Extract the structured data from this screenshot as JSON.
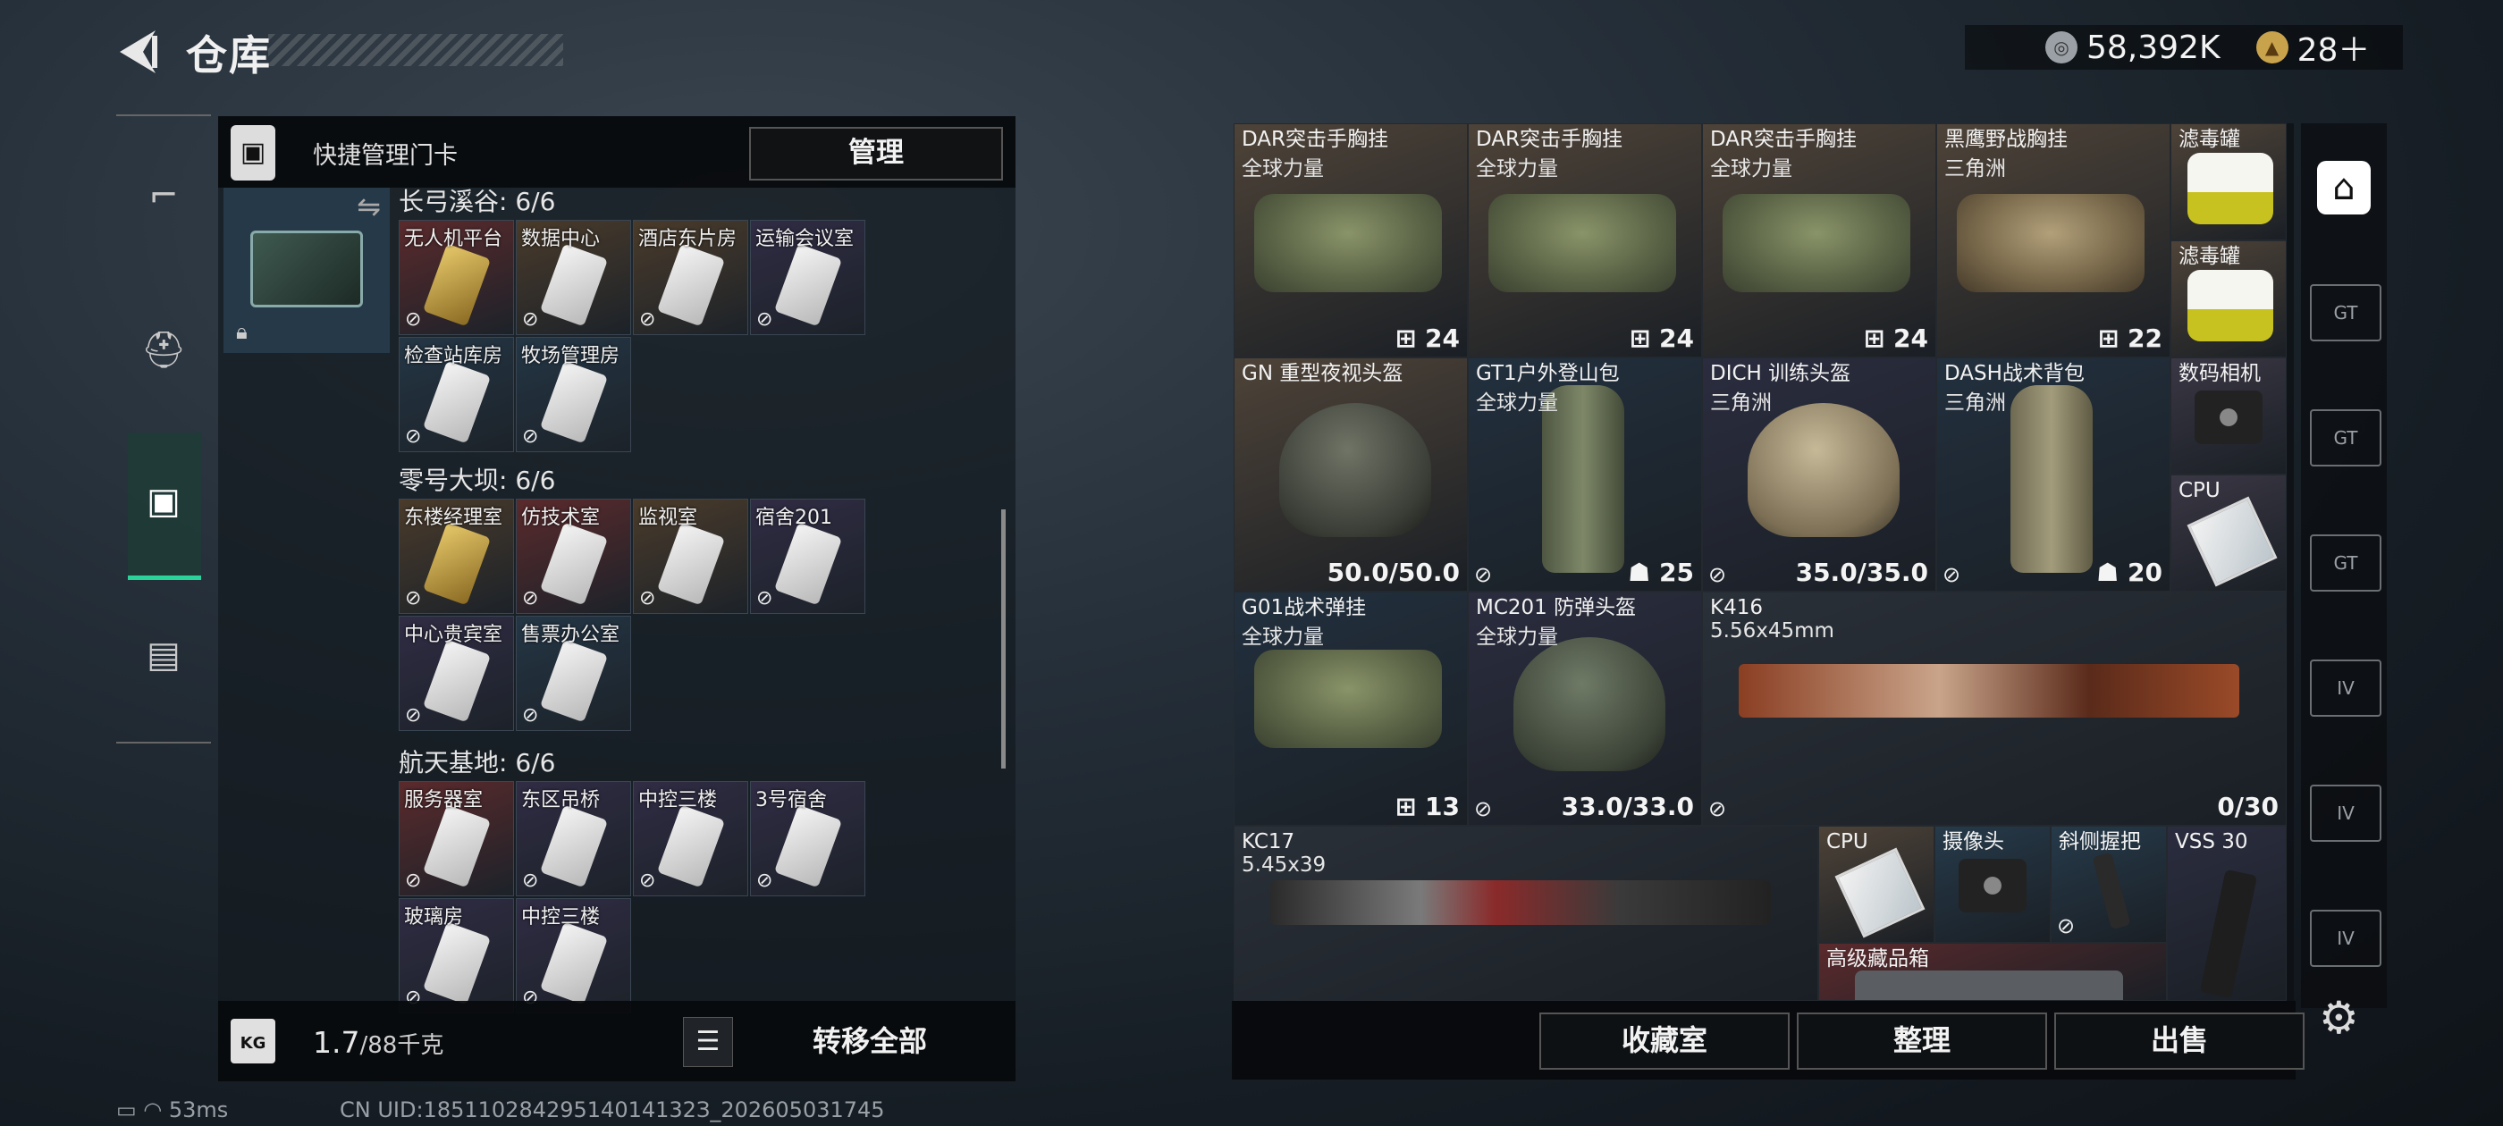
{
  "header": {
    "title": "仓库",
    "currency1": "58,392K",
    "currency2": "28＋"
  },
  "quick_card": {
    "label": "快捷管理门卡",
    "manage": "管理"
  },
  "maps": [
    {
      "title": "长弓溪谷: 6/6",
      "keys": [
        "无人机平台",
        "数据中心",
        "酒店东片房",
        "运输会议室",
        "检查站库房",
        "牧场管理房"
      ]
    },
    {
      "title": "零号大坝: 6/6",
      "keys": [
        "东楼经理室",
        "仿技术室",
        "监视室",
        "宿舍201",
        "中心贵宾室",
        "售票办公室"
      ]
    },
    {
      "title": "航天基地: 6/6",
      "keys": [
        "服务器室",
        "东区吊桥",
        "中控三楼",
        "3号宿舍",
        "玻璃房",
        "中控三楼"
      ]
    }
  ],
  "footer_left": {
    "weight": "1.7",
    "capacity": "/88千克",
    "transfer": "转移全部"
  },
  "items": [
    {
      "name": "DAR突击手胸挂",
      "sub": "全球力量",
      "count": "24"
    },
    {
      "name": "DAR突击手胸挂",
      "sub": "全球力量",
      "count": "24"
    },
    {
      "name": "DAR突击手胸挂",
      "sub": "全球力量",
      "count": "24"
    },
    {
      "name": "黑鹰野战胸挂",
      "sub": "三角洲",
      "count": "22"
    },
    {
      "name": "滤毒罐",
      "sub": "",
      "count": ""
    },
    {
      "name": "滤毒罐",
      "sub": "",
      "count": ""
    },
    {
      "name": "GN 重型夜视头盔",
      "sub": "",
      "count": "50.0/50.0"
    },
    {
      "name": "GT1户外登山包",
      "sub": "全球力量",
      "count": "25"
    },
    {
      "name": "DICH 训练头盔",
      "sub": "三角洲",
      "count": "35.0/35.0"
    },
    {
      "name": "DASH战术背包",
      "sub": "三角洲",
      "count": "20"
    },
    {
      "name": "数码相机",
      "sub": "",
      "count": ""
    },
    {
      "name": "CPU",
      "sub": "",
      "count": ""
    },
    {
      "name": "G01战术弹挂",
      "sub": "全球力量",
      "count": "13"
    },
    {
      "name": "MC201 防弹头盔",
      "sub": "全球力量",
      "count": "33.0/33.0"
    },
    {
      "name": "K416",
      "sub": "5.56x45mm",
      "count": "0/30"
    },
    {
      "name": "KC17",
      "sub": "5.45x39",
      "count": ""
    },
    {
      "name": "CPU",
      "sub": "",
      "count": ""
    },
    {
      "name": "摄像头",
      "sub": "",
      "count": ""
    },
    {
      "name": "斜侧握把",
      "sub": "",
      "count": ""
    },
    {
      "name": "VSS 30",
      "sub": "",
      "count": ""
    },
    {
      "name": "高级藏品箱",
      "sub": "",
      "count": ""
    }
  ],
  "footer_right": {
    "collection": "收藏室",
    "sort": "整理",
    "sell": "出售"
  },
  "status": {
    "ping": "53ms",
    "uid": "CN UID:18511028429514014132З_202605031745"
  },
  "colors": {
    "accent": "#2ad39a",
    "red_rarity": "#5a2a2c",
    "gold_rarity": "#4a3b2a",
    "blue_rarity": "#243645",
    "purple_rarity": "#302c44"
  }
}
